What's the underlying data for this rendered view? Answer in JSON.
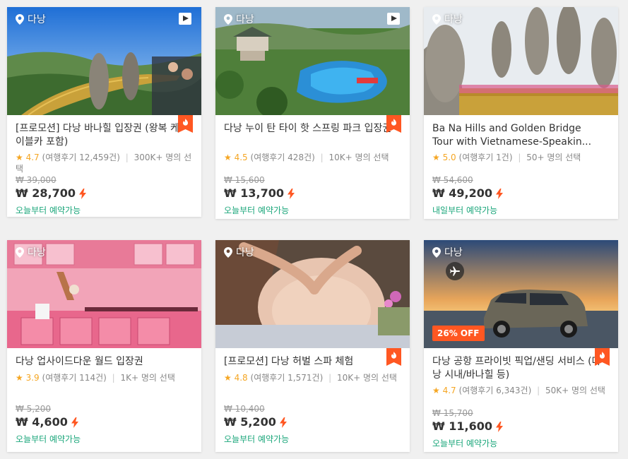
{
  "cards": [
    {
      "location": "다낭",
      "title": "[프로모션] 다낭 바나힐 입장권 (왕복 케이블카 포함)",
      "rating": "4.7",
      "reviews": "(여행후기 12,459건)",
      "booked": "300K+ 명의 선택",
      "original_price": "₩ 39,000",
      "price": "₩ 28,700",
      "availability": "오늘부터 예약가능"
    },
    {
      "location": "다낭",
      "title": "다낭 누이 탄 타이 핫 스프링 파크 입장권",
      "rating": "4.5",
      "reviews": "(여행후기 428건)",
      "booked": "10K+ 명의 선택",
      "original_price": "₩ 15,600",
      "price": "₩ 13,700",
      "availability": "오늘부터 예약가능"
    },
    {
      "location": "다낭",
      "title": "Ba Na Hills and Golden Bridge Tour with Vietnamese-Speakin...",
      "rating": "5.0",
      "reviews": "(여행후기 1건)",
      "booked": "50+ 명의 선택",
      "original_price": "₩ 54,600",
      "price": "₩ 49,200",
      "availability": "내일부터 예약가능"
    },
    {
      "location": "다낭",
      "title": "다낭 업사이드다운 월드 입장권",
      "rating": "3.9",
      "reviews": "(여행후기 114건)",
      "booked": "1K+ 명의 선택",
      "original_price": "₩ 5,200",
      "price": "₩ 4,600",
      "availability": "오늘부터 예약가능"
    },
    {
      "location": "다낭",
      "title": "[프로모션] 다낭 허벌 스파 체험",
      "rating": "4.8",
      "reviews": "(여행후기 1,571건)",
      "booked": "10K+ 명의 선택",
      "original_price": "₩ 10,400",
      "price": "₩ 5,200",
      "availability": "오늘부터 예약가능"
    },
    {
      "location": "다낭",
      "title": "다낭 공항 프라이빗 픽업/샌딩 서비스 (다낭 시내/바나힐 등)",
      "rating": "4.7",
      "reviews": "(여행후기 6,343건)",
      "booked": "50K+ 명의 선택",
      "original_price": "₩ 15,700",
      "price": "₩ 11,600",
      "availability": "오늘부터 예약가능",
      "discount": "26% OFF"
    }
  ],
  "icons": {
    "location": "map-pin-icon",
    "video": "play-icon",
    "hot": "fire-icon",
    "instant": "lightning-icon",
    "airport": "airplane-icon",
    "star": "star-icon"
  },
  "colors": {
    "accent_orange": "#ff5722",
    "rating_star": "#f5a623",
    "availability_green": "#1aa67a",
    "bolt_red": "#ff5722"
  }
}
